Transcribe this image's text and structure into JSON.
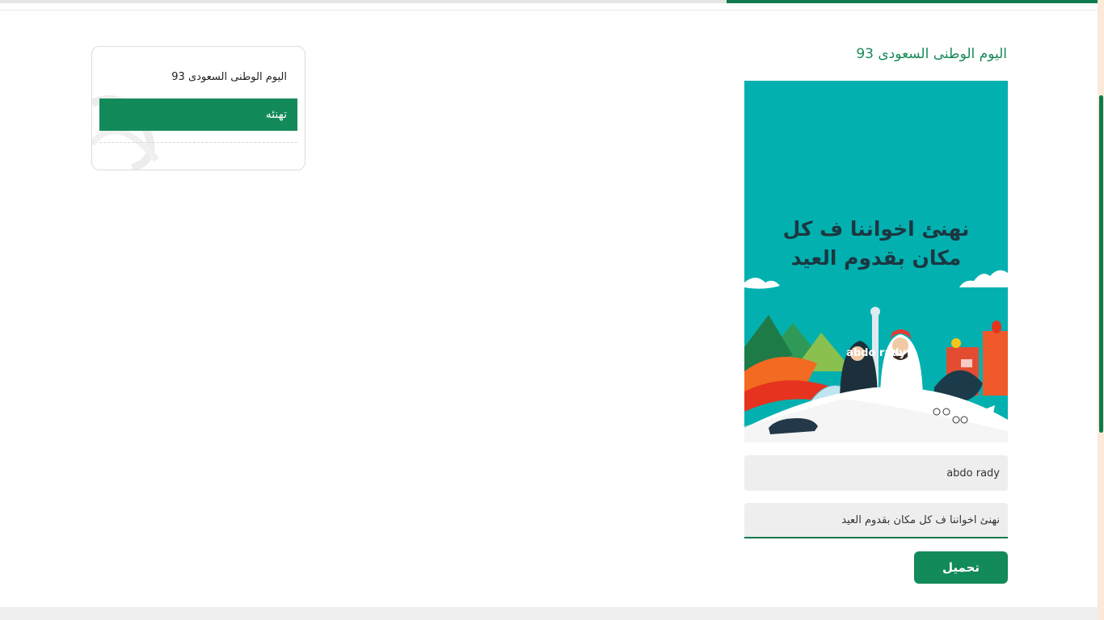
{
  "page": {
    "title": "اليوم الوطنى السعودى 93"
  },
  "card_image": {
    "greeting": "نهنئ اخواننا ف كل مكان بقدوم العيد",
    "name": "abdo rady",
    "background_color": "#03b0b0"
  },
  "form": {
    "name_value": "abdo rady",
    "message_value": "نهنئ اخواننا ف كل مكان بقدوم العيد",
    "download_label": "تحميل"
  },
  "side_card": {
    "title": "اليوم الوطنى السعودى 93",
    "button_label": "تهنئه"
  },
  "colors": {
    "brand_green": "#128a5a",
    "title_green": "#168a59",
    "field_bg": "#eeeeee"
  }
}
